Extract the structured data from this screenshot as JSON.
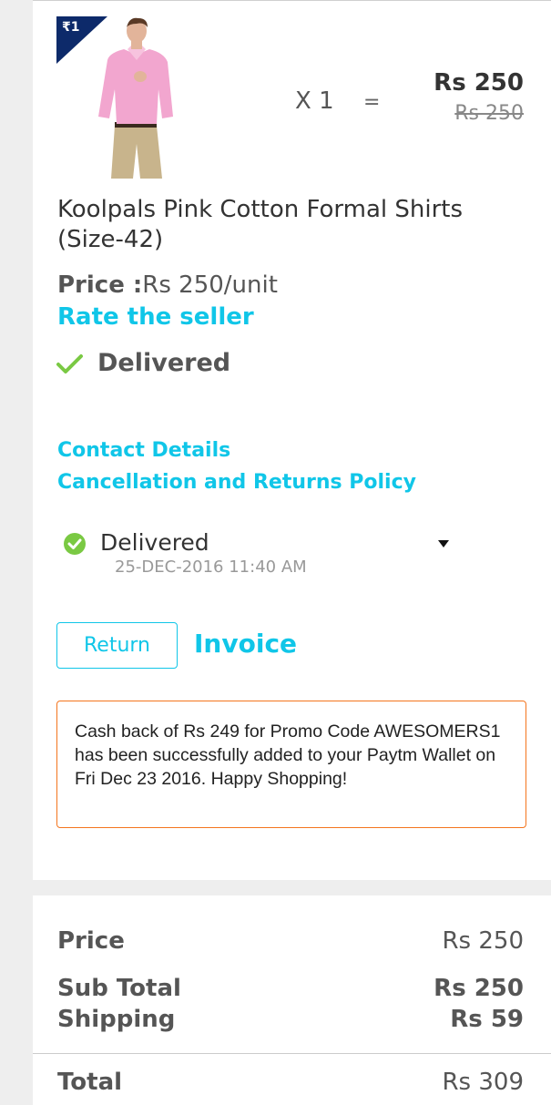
{
  "product": {
    "badge": "₹1",
    "quantity": "X 1",
    "equals": "=",
    "total_price": "Rs 250",
    "original_price": "Rs 250",
    "title": "Koolpals Pink Cotton Formal Shirts (Size-42)",
    "price_label": "Price :",
    "price_value": "Rs 250/unit",
    "rate_seller": "Rate the seller",
    "status_big": "Delivered"
  },
  "links": {
    "contact": "Contact Details",
    "policy": "Cancellation and Returns Policy"
  },
  "status": {
    "label": "Delivered",
    "date": "25-DEC-2016 11:40 AM"
  },
  "actions": {
    "return_label": "Return",
    "invoice_label": "Invoice"
  },
  "cashback_message": "Cash back of Rs 249 for Promo Code AWESOMERS1 has been successfully added to your Paytm Wallet on Fri Dec 23 2016. Happy Shopping!",
  "summary": {
    "price_label": "Price",
    "price_value": "Rs 250",
    "subtotal_label": "Sub Total",
    "subtotal_value": "Rs 250",
    "shipping_label": "Shipping",
    "shipping_value": "Rs 59",
    "total_label": "Total",
    "total_value": "Rs 309"
  },
  "colors": {
    "link": "#10c6e8",
    "check": "#7ac943",
    "badge": "#0d2a6a",
    "cashback_border": "#f4751e"
  }
}
